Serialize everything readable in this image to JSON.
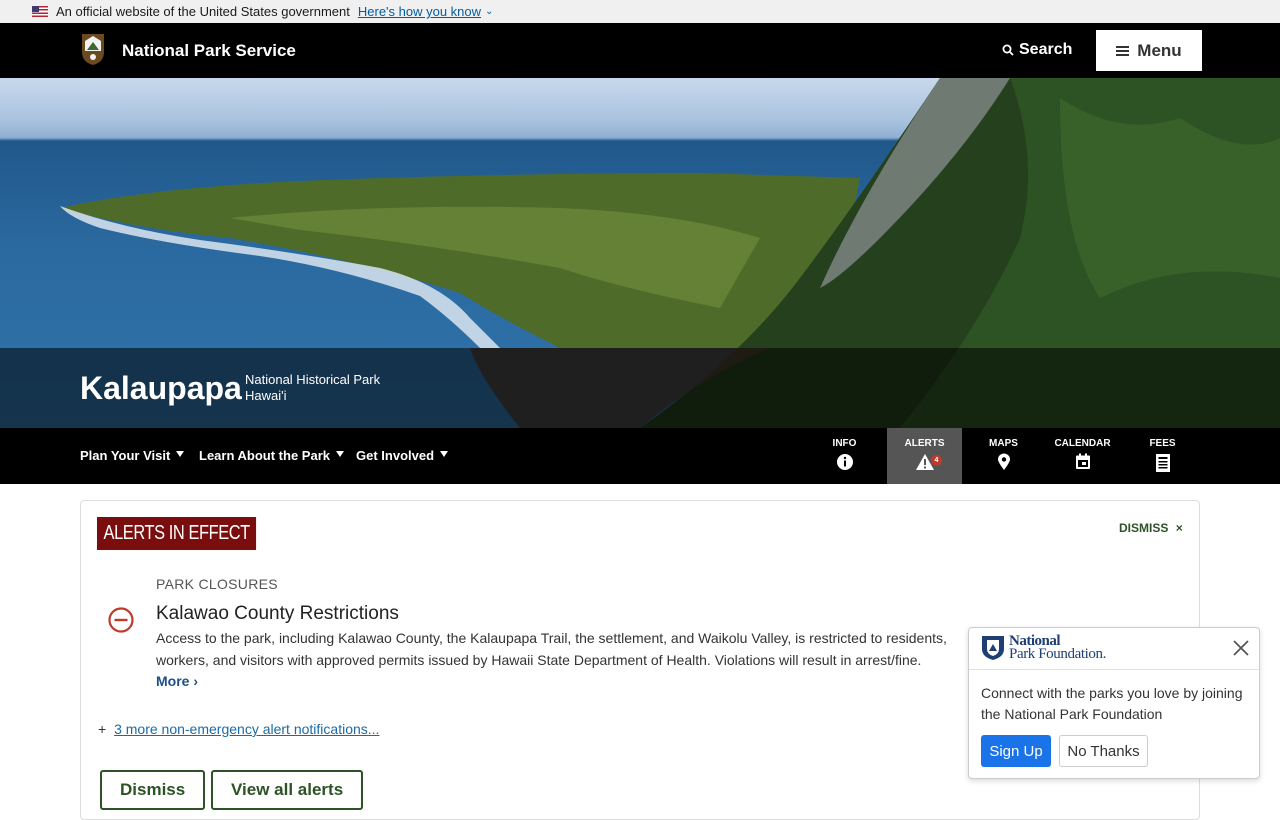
{
  "gov_banner": {
    "text": "An official website of the United States government",
    "link": "Here's how you know",
    "flag_icon": "us-flag-icon",
    "chevron_icon": "chevron-down-icon"
  },
  "header": {
    "brand": "National Park Service",
    "logo_icon": "nps-arrowhead-icon",
    "search_label": "Search",
    "menu_label": "Menu",
    "background": "#000000"
  },
  "hero": {
    "park_name": "Kalaupapa",
    "designation": "National Historical Park",
    "state": "Hawai'i"
  },
  "park_nav": {
    "links": [
      {
        "label": "Plan Your Visit"
      },
      {
        "label": "Learn About the Park"
      },
      {
        "label": "Get Involved"
      }
    ],
    "quick": [
      {
        "label": "INFO",
        "icon": "info-icon"
      },
      {
        "label": "ALERTS",
        "icon": "alert-triangle-icon",
        "badge": "4",
        "active": true
      },
      {
        "label": "MAPS",
        "icon": "map-pin-icon"
      },
      {
        "label": "CALENDAR",
        "icon": "calendar-icon"
      },
      {
        "label": "FEES",
        "icon": "fees-receipt-icon"
      }
    ]
  },
  "alerts": {
    "heading": "ALERTS IN EFFECT",
    "dismiss_top": "DISMISS",
    "close_icon": "close-icon",
    "category": "PARK CLOSURES",
    "status_icon": "closure-icon",
    "title": "Kalawao County Restrictions",
    "body": "Access to the park, including Kalawao County, the Kalaupapa Trail, the settlement, and Waikolu Valley, is restricted to residents, workers, and visitors with approved permits issued by Hawaii State Department of Health. Violations will result in arrest/fine.",
    "more": "More",
    "more_alerts_prefix": "+",
    "more_alerts_link": "3 more non-emergency alert notifications...",
    "dismiss_button": "Dismiss",
    "view_all_button": "View all alerts",
    "colors": {
      "tag": "#7a0e0e",
      "green": "#2d5226",
      "closure": "#c0392b"
    }
  },
  "npf_popup": {
    "logo_line1": "National",
    "logo_line2": "Park Foundation.",
    "message": "Connect with the parks you love by joining the National Park Foundation",
    "signup": "Sign Up",
    "no_thanks": "No Thanks",
    "accent": "#1a73e8"
  }
}
